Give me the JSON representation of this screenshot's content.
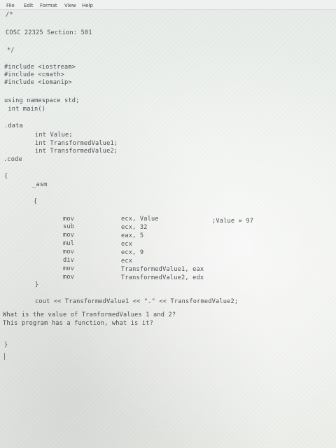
{
  "menu": {
    "file": "File",
    "edit": "Edit",
    "format": "Format",
    "view": "View",
    "help": "Help"
  },
  "editor": {
    "l01": "/*",
    "l02": "COSC 22325 Section: 501",
    "l03": "*/",
    "l04": "#include <iostream>",
    "l05": "#include <cmath>",
    "l06": "#include <iomanip>",
    "l07": "using namespace std;",
    "l08": " int main()",
    "l09": ".data",
    "l10": "int Value;",
    "l11": "int TransformedValue1;",
    "l12": "int TransformedValue2;",
    "l13": ".code",
    "l14": "{",
    "l15": "_asm",
    "l16": "{",
    "asm": [
      {
        "op": "mov",
        "args": "ecx, Value",
        "comment": ";Value = 97"
      },
      {
        "op": "sub",
        "args": "ecx, 32"
      },
      {
        "op": "mov",
        "args": "eax, 5"
      },
      {
        "op": "mul",
        "args": "ecx"
      },
      {
        "op": "mov",
        "args": "ecx, 9"
      },
      {
        "op": "div",
        "args": "ecx"
      },
      {
        "op": "mov",
        "args": "TransformedValue1, eax"
      },
      {
        "op": "mov",
        "args": "TransformedValue2, edx"
      }
    ],
    "l17": "}",
    "l18": "cout << TransformedValue1 << \".\" << TransformedValue2;",
    "l19": "What is the value of TranformedValues 1 and 2?",
    "l20": "This program has a function, what is it?",
    "l21": "}"
  }
}
